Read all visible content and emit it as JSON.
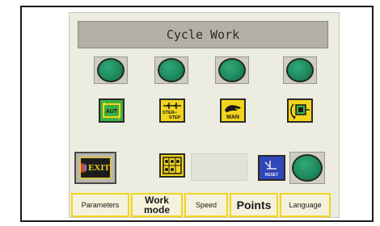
{
  "title": "Cycle Work",
  "lamps": [
    {
      "name": "lamp-1",
      "color": "#1f8a5e"
    },
    {
      "name": "lamp-2",
      "color": "#1f8a5e"
    },
    {
      "name": "lamp-3",
      "color": "#1f8a5e"
    },
    {
      "name": "lamp-4",
      "color": "#1f8a5e"
    },
    {
      "name": "lamp-5",
      "color": "#1f8a5e"
    }
  ],
  "mode_buttons": {
    "auto": {
      "icon": "auto-cycle-icon",
      "label": "AUT"
    },
    "step": {
      "icon": "step-by-step-icon",
      "label_line1": "STEP",
      "label_by": "BY",
      "label_line2": "STEP"
    },
    "manual": {
      "icon": "manual-hand-icon",
      "label": "MAN"
    },
    "cycle": {
      "icon": "cycle-robot-icon"
    }
  },
  "exit_button": {
    "label": "EXIT",
    "icon": "exit-door-icon"
  },
  "grid_button": {
    "icon": "grid-matrix-icon"
  },
  "reset_button": {
    "icon": "reset-icon",
    "label": "RESET"
  },
  "tabs": [
    {
      "label": "Parameters"
    },
    {
      "label": "Work mode"
    },
    {
      "label": "Speed"
    },
    {
      "label": "Points"
    },
    {
      "label": "Language"
    }
  ],
  "colors": {
    "accent_yellow": "#f3d51b",
    "lamp_green": "#1f8a5e",
    "button_green": "#3cb043",
    "button_blue": "#2f47b8",
    "panel_bg": "#ecece0"
  }
}
